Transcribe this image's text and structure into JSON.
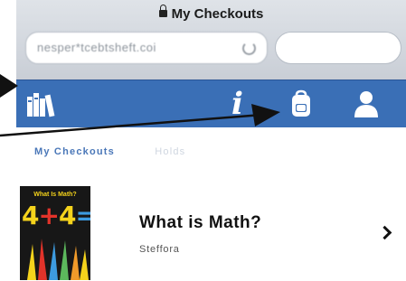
{
  "header": {
    "title": "My Checkouts"
  },
  "address_bar": {
    "url": "nesper*tcebtsheft.coi"
  },
  "toolbar": {
    "icons": [
      "books-icon",
      "info-icon",
      "backpack-icon",
      "user-icon"
    ],
    "info_glyph": "i",
    "background": "#3a6fb6"
  },
  "tabs": [
    {
      "label": "My Checkouts",
      "active": true
    },
    {
      "label": "Holds",
      "active": false
    }
  ],
  "checkouts": [
    {
      "title": "What is Math?",
      "author": "Steffora",
      "cover": {
        "title": "What Is Math?",
        "equation": [
          "4",
          "+",
          "4",
          "="
        ]
      }
    }
  ],
  "colors": {
    "accent": "#4a77b8",
    "toolbar": "#3a6fb6",
    "cover_yellow": "#f5d31c",
    "cover_red": "#e2332a",
    "cover_blue": "#3d9be0"
  }
}
